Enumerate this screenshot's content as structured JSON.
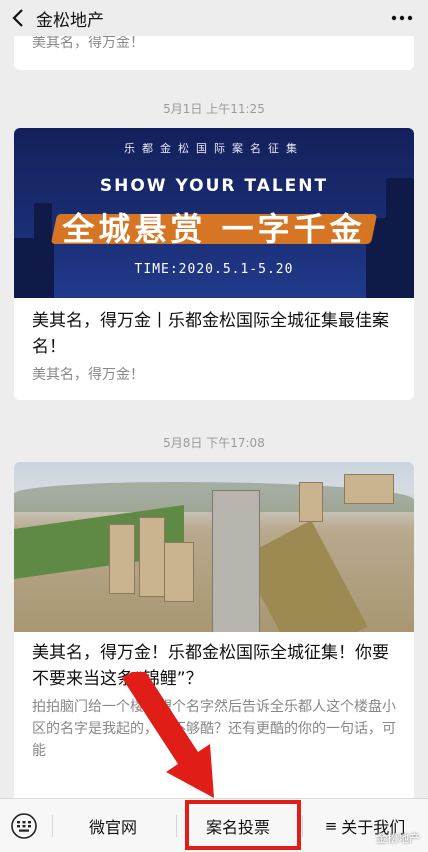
{
  "header": {
    "title": "金松地产",
    "back_icon": "back-chevron-icon",
    "more_icon": "more-dots-icon"
  },
  "top_card": {
    "digest": "美其名，得万金！"
  },
  "messages": [
    {
      "timestamp": "5月1日 上午11:25",
      "banner": {
        "tagline": "乐都金松国际案名征集",
        "show": "SHOW YOUR TALENT",
        "headline": "全城悬赏 一字千金",
        "time": "TIME:2020.5.1-5.20"
      },
      "title": "美其名，得万金丨乐都金松国际全城征集最佳案名！",
      "digest": "美其名，得万金！"
    },
    {
      "timestamp": "5月8日 下午17:08",
      "title": "美其名，得万金！乐都金松国际全城征集！你要不要来当这条“锦鲤”？",
      "digest": "拍拍脑门给一个楼盘想个名字然后告诉全乐都人这个楼盘小区的名字是我起的，够不够酷？还有更酷的你的一句话，可能"
    }
  ],
  "bottom_menu": {
    "keyboard_icon": "keyboard-icon",
    "items": [
      {
        "label": "微官网"
      },
      {
        "label": "案名投票"
      },
      {
        "label": "关于我们",
        "icon": "≡"
      }
    ]
  },
  "watermark": "金松地产",
  "colors": {
    "annotation_red": "#e11d18",
    "banner_blue": "#1a2d72",
    "brush_orange": "#e07a21"
  }
}
